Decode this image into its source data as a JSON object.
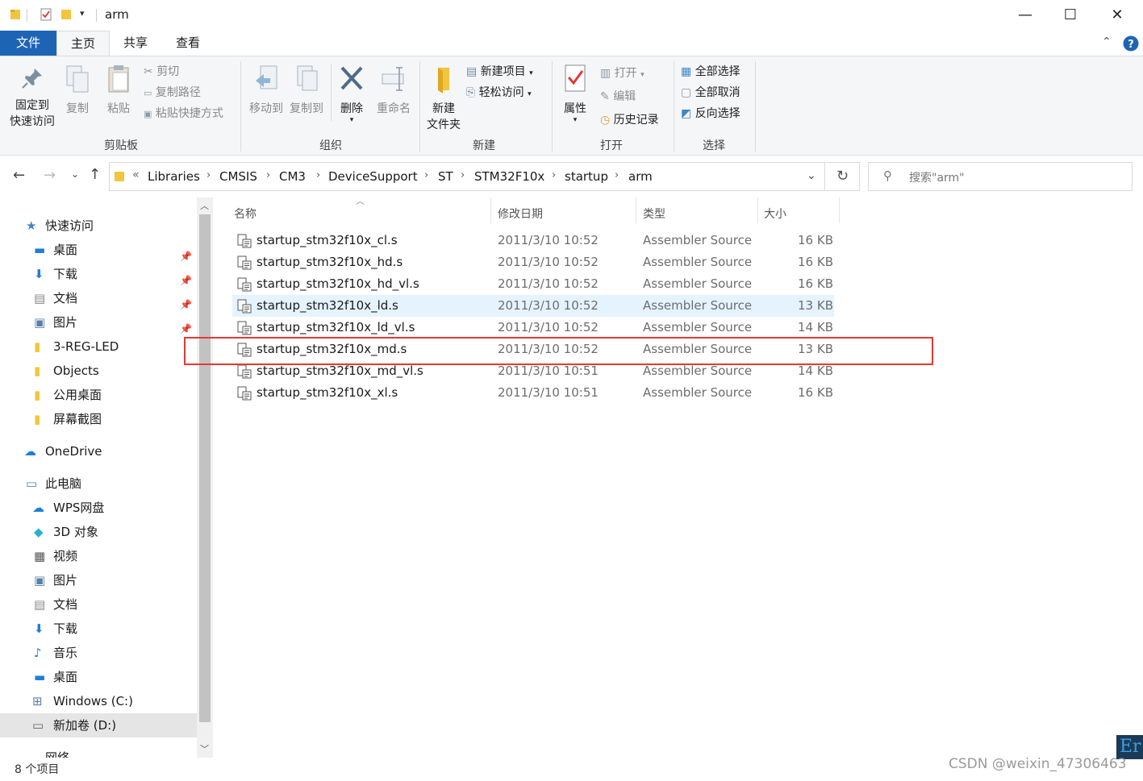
{
  "window": {
    "title": "arm",
    "minimize_glyph": "—",
    "maximize_glyph": "☐",
    "close_glyph": "✕"
  },
  "menu": {
    "tabs": [
      "文件",
      "主页",
      "共享",
      "查看"
    ],
    "active": "主页"
  },
  "ribbon": {
    "clipboard": {
      "label": "剪贴板",
      "pin_line1": "固定到",
      "pin_line2": "快速访问",
      "copy": "复制",
      "paste": "粘贴",
      "cut": "剪切",
      "copy_path": "复制路径",
      "paste_shortcut": "粘贴快捷方式"
    },
    "organize": {
      "label": "组织",
      "move_to": "移动到",
      "copy_to": "复制到",
      "delete": "删除",
      "rename": "重命名"
    },
    "new": {
      "label": "新建",
      "new_folder_line1": "新建",
      "new_folder_line2": "文件夹",
      "new_item": "新建项目",
      "easy_access": "轻松访问"
    },
    "open": {
      "label": "打开",
      "properties": "属性",
      "open": "打开",
      "edit": "编辑",
      "history": "历史记录"
    },
    "select": {
      "label": "选择",
      "select_all": "全部选择",
      "select_none": "全部取消",
      "invert": "反向选择"
    }
  },
  "address": {
    "overflow": "«",
    "crumbs": [
      "Libraries",
      "CMSIS",
      "CM3",
      "DeviceSupport",
      "ST",
      "STM32F10x",
      "startup",
      "arm"
    ],
    "search_placeholder": "搜索\"arm\""
  },
  "nav": {
    "quick_access": "快速访问",
    "quick_items": [
      {
        "label": "桌面",
        "pinned": true
      },
      {
        "label": "下载",
        "pinned": true
      },
      {
        "label": "文档",
        "pinned": true
      },
      {
        "label": "图片",
        "pinned": true
      },
      {
        "label": "3-REG-LED",
        "pinned": false
      },
      {
        "label": "Objects",
        "pinned": false
      },
      {
        "label": "公用桌面",
        "pinned": false
      },
      {
        "label": "屏幕截图",
        "pinned": false
      }
    ],
    "onedrive": "OneDrive",
    "this_pc": "此电脑",
    "pc_items": [
      "WPS网盘",
      "3D 对象",
      "视频",
      "图片",
      "文档",
      "下载",
      "音乐",
      "桌面",
      "Windows (C:)",
      "新加卷 (D:)"
    ],
    "network": "网络"
  },
  "columns": {
    "name": "名称",
    "date": "修改日期",
    "type": "类型",
    "size": "大小"
  },
  "files": [
    {
      "name": "startup_stm32f10x_cl.s",
      "date": "2011/3/10 10:52",
      "type": "Assembler Source",
      "size": "16 KB"
    },
    {
      "name": "startup_stm32f10x_hd.s",
      "date": "2011/3/10 10:52",
      "type": "Assembler Source",
      "size": "16 KB"
    },
    {
      "name": "startup_stm32f10x_hd_vl.s",
      "date": "2011/3/10 10:52",
      "type": "Assembler Source",
      "size": "16 KB"
    },
    {
      "name": "startup_stm32f10x_ld.s",
      "date": "2011/3/10 10:52",
      "type": "Assembler Source",
      "size": "13 KB"
    },
    {
      "name": "startup_stm32f10x_ld_vl.s",
      "date": "2011/3/10 10:52",
      "type": "Assembler Source",
      "size": "14 KB"
    },
    {
      "name": "startup_stm32f10x_md.s",
      "date": "2011/3/10 10:52",
      "type": "Assembler Source",
      "size": "13 KB"
    },
    {
      "name": "startup_stm32f10x_md_vl.s",
      "date": "2011/3/10 10:51",
      "type": "Assembler Source",
      "size": "14 KB"
    },
    {
      "name": "startup_stm32f10x_xl.s",
      "date": "2011/3/10 10:51",
      "type": "Assembler Source",
      "size": "16 KB"
    }
  ],
  "status": {
    "count": "8 个项目"
  },
  "watermark": "CSDN @weixin_47306463",
  "colors": {
    "accent": "#1e64b4",
    "highlight_row": "#e5f3ff",
    "annotation_box": "#e53935",
    "selected_nav": "#e5e5e5"
  }
}
